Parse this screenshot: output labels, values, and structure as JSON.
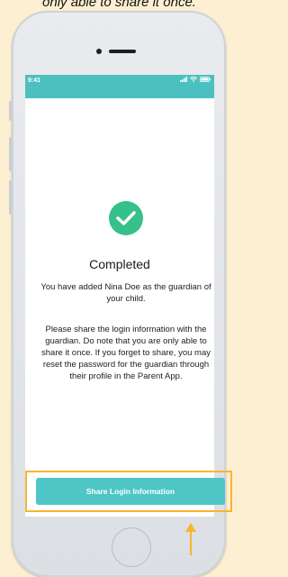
{
  "caption": "only able to share it once.",
  "statusbar": {
    "time": "9:41",
    "icons": [
      "signal-icon",
      "wifi-icon",
      "battery-icon"
    ]
  },
  "content": {
    "title": "Completed",
    "message": "You have added Nina Doe as the guardian of your child.",
    "instructions": "Please share the login information with the guardian. Do note that you are only able to share it once. If you forget to share, you may reset the password for the guardian through their profile in the Parent App."
  },
  "actions": {
    "share_label": "Share Login Information"
  },
  "colors": {
    "accent": "#4cc0c0",
    "check": "#36c08a",
    "highlight": "#f7b62f",
    "background": "#fdefd2"
  }
}
